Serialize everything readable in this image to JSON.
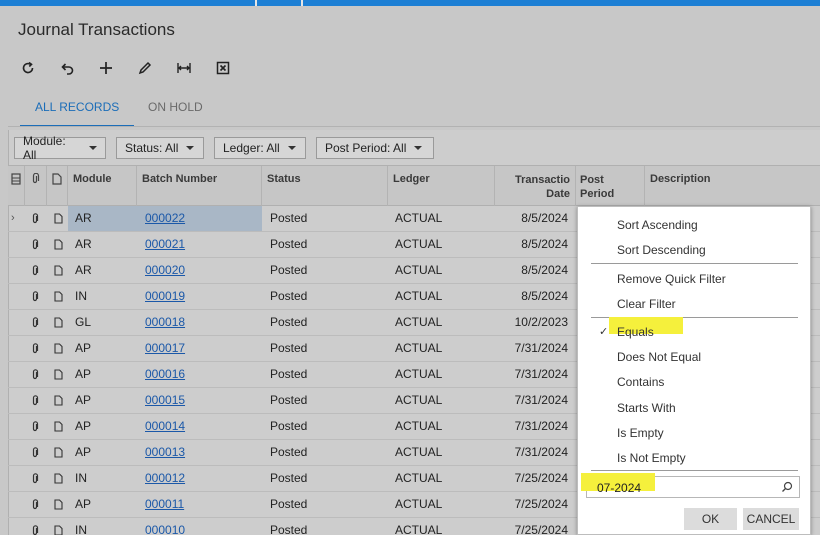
{
  "window": {
    "title": "Journal Transactions"
  },
  "toolbar": {
    "buttons": [
      {
        "name": "refresh-icon"
      },
      {
        "name": "undo-icon"
      },
      {
        "name": "add-icon"
      },
      {
        "name": "edit-icon"
      },
      {
        "name": "fit-to-screen-icon"
      },
      {
        "name": "export-excel-icon"
      }
    ]
  },
  "tabs": [
    {
      "label": "ALL RECORDS",
      "active": true
    },
    {
      "label": "ON HOLD",
      "active": false
    }
  ],
  "filters": [
    {
      "label": "Module: All"
    },
    {
      "label": "Status: All"
    },
    {
      "label": "Ledger: All"
    },
    {
      "label": "Post Period: All"
    }
  ],
  "columns": {
    "module": "Module",
    "batch": "Batch Number",
    "status": "Status",
    "ledger": "Ledger",
    "date_line1": "Transactio",
    "date_line2": "Date",
    "period_line1": "Post",
    "period_line2": "Period",
    "description": "Description"
  },
  "rows": [
    {
      "module": "AR",
      "batch": "000022",
      "status": "Posted",
      "ledger": "ACTUAL",
      "date": "8/5/2024",
      "selected": true
    },
    {
      "module": "AR",
      "batch": "000021",
      "status": "Posted",
      "ledger": "ACTUAL",
      "date": "8/5/2024"
    },
    {
      "module": "AR",
      "batch": "000020",
      "status": "Posted",
      "ledger": "ACTUAL",
      "date": "8/5/2024"
    },
    {
      "module": "IN",
      "batch": "000019",
      "status": "Posted",
      "ledger": "ACTUAL",
      "date": "8/5/2024"
    },
    {
      "module": "GL",
      "batch": "000018",
      "status": "Posted",
      "ledger": "ACTUAL",
      "date": "10/2/2023"
    },
    {
      "module": "AP",
      "batch": "000017",
      "status": "Posted",
      "ledger": "ACTUAL",
      "date": "7/31/2024"
    },
    {
      "module": "AP",
      "batch": "000016",
      "status": "Posted",
      "ledger": "ACTUAL",
      "date": "7/31/2024"
    },
    {
      "module": "AP",
      "batch": "000015",
      "status": "Posted",
      "ledger": "ACTUAL",
      "date": "7/31/2024"
    },
    {
      "module": "AP",
      "batch": "000014",
      "status": "Posted",
      "ledger": "ACTUAL",
      "date": "7/31/2024"
    },
    {
      "module": "AP",
      "batch": "000013",
      "status": "Posted",
      "ledger": "ACTUAL",
      "date": "7/31/2024"
    },
    {
      "module": "IN",
      "batch": "000012",
      "status": "Posted",
      "ledger": "ACTUAL",
      "date": "7/25/2024"
    },
    {
      "module": "AP",
      "batch": "000011",
      "status": "Posted",
      "ledger": "ACTUAL",
      "date": "7/25/2024"
    },
    {
      "module": "IN",
      "batch": "000010",
      "status": "Posted",
      "ledger": "ACTUAL",
      "date": "7/25/2024"
    }
  ],
  "column_menu": {
    "sort_asc": "Sort Ascending",
    "sort_desc": "Sort Descending",
    "remove_filter": "Remove Quick Filter",
    "clear_filter": "Clear Filter",
    "equals": "Equals",
    "not_equal": "Does Not Equal",
    "contains": "Contains",
    "starts_with": "Starts With",
    "is_empty": "Is Empty",
    "is_not_empty": "Is Not Empty",
    "filter_value": "07-2024",
    "ok_label": "OK",
    "cancel_label": "CANCEL"
  },
  "colors": {
    "accent": "#1b6db8",
    "highlight": "#f5f03c",
    "link": "#1b58a8"
  }
}
